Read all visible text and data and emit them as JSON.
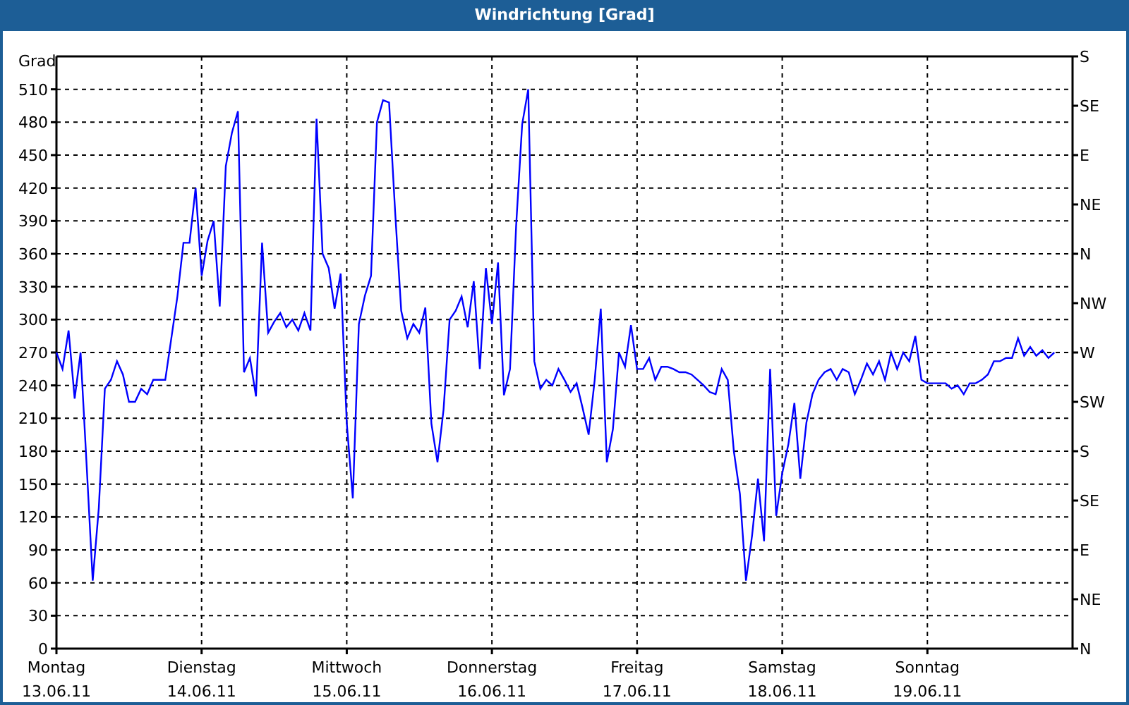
{
  "window": {
    "title": "Windrichtung [Grad]"
  },
  "chart": {
    "chart_data": {
      "type": "line",
      "grid": true,
      "ylabel": "Grad",
      "ylim": [
        0,
        540
      ],
      "yticks": [
        0,
        30,
        60,
        90,
        120,
        150,
        180,
        210,
        240,
        270,
        300,
        330,
        360,
        390,
        420,
        450,
        480,
        510
      ],
      "categories": [
        "Montag 13.06.11",
        null,
        null,
        null,
        null,
        null,
        null,
        null,
        null,
        null,
        null,
        null,
        null,
        null,
        null,
        null,
        null,
        null,
        null,
        null,
        null,
        null,
        null,
        null,
        "Dienstag 14.06.11",
        null,
        null,
        null,
        null,
        null,
        null,
        null,
        null,
        null,
        null,
        null,
        null,
        null,
        null,
        null,
        null,
        null,
        null,
        null,
        null,
        null,
        null,
        null,
        "Mittwoch 15.06.11",
        null,
        null,
        null,
        null,
        null,
        null,
        null,
        null,
        null,
        null,
        null,
        null,
        null,
        null,
        null,
        null,
        null,
        null,
        null,
        null,
        null,
        null,
        null,
        "Donnerstag 16.06.11",
        null,
        null,
        null,
        null,
        null,
        null,
        null,
        null,
        null,
        null,
        null,
        null,
        null,
        null,
        null,
        null,
        null,
        null,
        null,
        null,
        null,
        null,
        null,
        "Freitag 17.06.11",
        null,
        null,
        null,
        null,
        null,
        null,
        null,
        null,
        null,
        null,
        null,
        null,
        null,
        null,
        null,
        null,
        null,
        null,
        null,
        null,
        null,
        null,
        null,
        "Samstag 18.06.11",
        null,
        null,
        null,
        null,
        null,
        null,
        null,
        null,
        null,
        null,
        null,
        null,
        null,
        null,
        null,
        null,
        null,
        null,
        null,
        null,
        null,
        null,
        null,
        "Sonntag 19.06.11",
        null,
        null,
        null,
        null,
        null,
        null,
        null,
        null,
        null,
        null,
        null,
        null,
        null,
        null,
        null,
        null,
        null,
        null,
        null,
        null,
        null,
        null,
        null
      ],
      "series": [
        {
          "color": "#0000ff",
          "values": [
            270,
            255,
            290,
            228,
            270,
            167,
            62,
            128,
            237,
            245,
            262,
            250,
            225,
            225,
            237,
            232,
            245,
            245,
            245,
            283,
            321,
            370,
            370,
            420,
            340,
            372,
            390,
            312,
            440,
            470,
            490,
            252,
            265,
            230,
            370,
            288,
            298,
            306,
            293,
            300,
            290,
            306,
            290,
            483,
            360,
            347,
            310,
            342,
            206,
            137,
            296,
            322,
            340,
            480,
            500,
            498,
            398,
            308,
            283,
            296,
            288,
            311,
            205,
            170,
            218,
            300,
            308,
            321,
            293,
            335,
            255,
            347,
            296,
            352,
            231,
            255,
            385,
            478,
            510,
            262,
            237,
            245,
            240,
            255,
            245,
            234,
            242,
            219,
            195,
            245,
            310,
            170,
            200,
            270,
            257,
            295,
            255,
            255,
            265,
            245,
            257,
            257,
            255,
            252,
            252,
            250,
            245,
            240,
            234,
            232,
            255,
            245,
            180,
            141,
            62,
            103,
            155,
            98,
            255,
            121,
            160,
            186,
            224,
            155,
            206,
            232,
            245,
            252,
            255,
            245,
            255,
            252,
            232,
            245,
            260,
            250,
            262,
            245,
            270,
            255,
            270,
            262,
            285,
            245,
            242,
            242,
            242,
            242,
            237,
            240,
            232,
            242,
            242,
            245,
            250,
            262,
            262,
            265,
            265,
            283,
            267,
            275,
            267,
            272,
            265,
            270,
            null,
            null
          ]
        }
      ]
    },
    "right_axis": {
      "labels": [
        "S",
        "SE",
        "E",
        "NE",
        "N",
        "NW",
        "W",
        "SW",
        "S",
        "SE",
        "E",
        "NE",
        "N"
      ]
    }
  }
}
